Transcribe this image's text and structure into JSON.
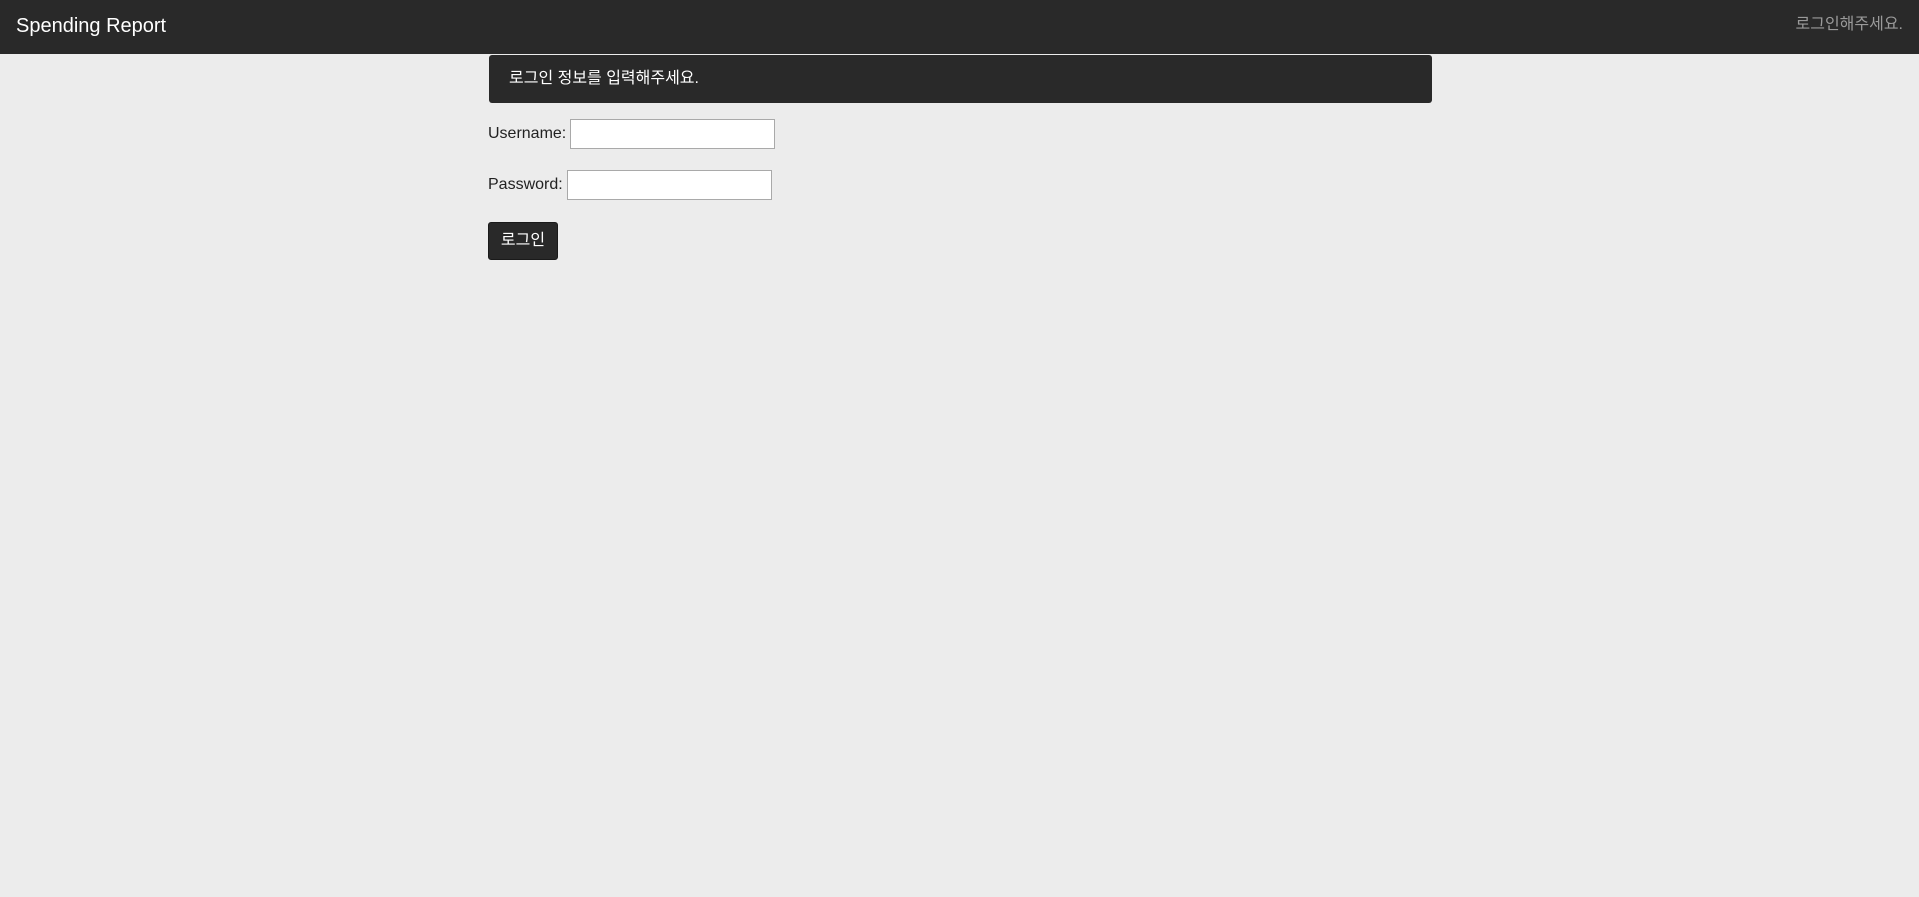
{
  "navbar": {
    "brand": "Spending Report",
    "status": "로그인해주세요.",
    "background_color": "#292929"
  },
  "alert": {
    "message": "로그인 정보를 입력해주세요."
  },
  "form": {
    "username_label": "Username:",
    "username_value": "",
    "password_label": "Password:",
    "password_value": "",
    "submit_label": "로그인"
  },
  "colors": {
    "page_background": "#ececec",
    "dark": "#292929",
    "status_text": "#9a9a9a"
  }
}
